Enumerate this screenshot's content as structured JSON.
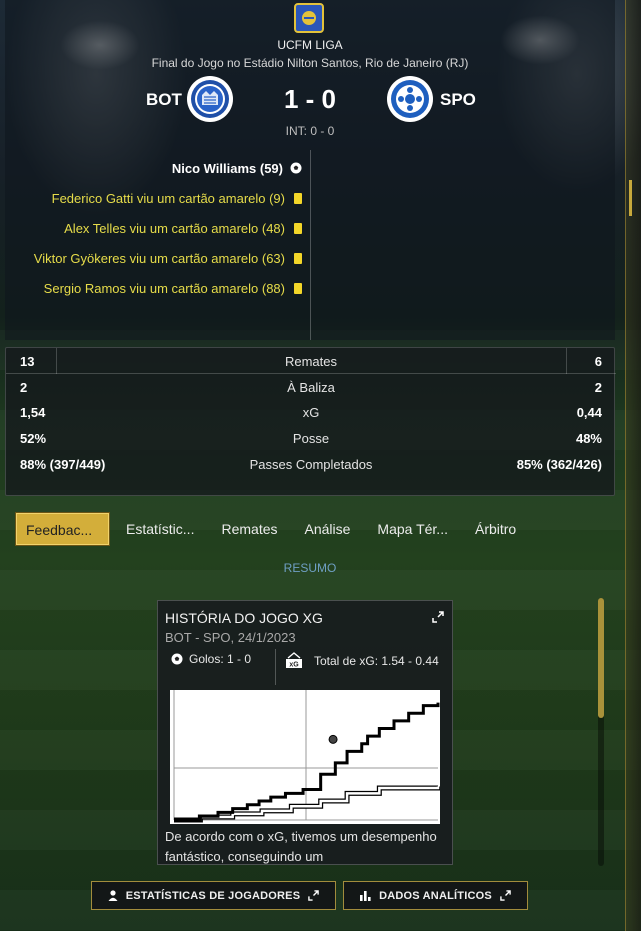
{
  "match": {
    "league": "UCFM LIGA",
    "venue": "Final do Jogo no Estádio Nilton Santos, Rio de Janeiro (RJ)",
    "home_abbr": "BOT",
    "away_abbr": "SPO",
    "score": "1 - 0",
    "halftime": "INT: 0 - 0"
  },
  "events": [
    {
      "text": "Nico Williams (59)",
      "type": "goal",
      "icon": "ball-icon"
    },
    {
      "text": "Federico Gatti viu um cartão amarelo (9)",
      "type": "yellow-card",
      "icon": "yellow-card-icon"
    },
    {
      "text": "Alex Telles viu um cartão amarelo (48)",
      "type": "yellow-card",
      "icon": "yellow-card-icon"
    },
    {
      "text": "Viktor Gyökeres viu um cartão amarelo (63)",
      "type": "yellow-card",
      "icon": "yellow-card-icon"
    },
    {
      "text": "Sergio Ramos viu um cartão amarelo (88)",
      "type": "yellow-card",
      "icon": "yellow-card-icon"
    }
  ],
  "stats": [
    {
      "label": "Remates",
      "home": "13",
      "away": "6"
    },
    {
      "label": "À Baliza",
      "home": "2",
      "away": "2"
    },
    {
      "label": "xG",
      "home": "1,54",
      "away": "0,44"
    },
    {
      "label": "Posse",
      "home": "52%",
      "away": "48%"
    },
    {
      "label": "Passes Completados",
      "home": "88% (397/449)",
      "away": "85% (362/426)"
    }
  ],
  "tabs": [
    "Feedbac...",
    "Estatístic...",
    "Remates",
    "Análise",
    "Mapa Tér...",
    "Árbitro"
  ],
  "active_tab": "Feedbac...",
  "section_label": "RESUMO",
  "xg_card": {
    "title": "HISTÓRIA DO JOGO XG",
    "subtitle": "BOT - SPO, 24/1/2023",
    "goals": "Golos: 1 - 0",
    "total_xg": "Total de xG: 1.54 - 0.44",
    "description": "De acordo com o xG, tivemos um desempenho fantástico, conseguindo um"
  },
  "chart_data": {
    "type": "line",
    "series": [
      {
        "x": [
          0,
          9,
          15,
          20,
          25,
          29,
          33,
          38,
          44,
          50,
          55,
          59,
          64,
          66,
          70,
          75,
          80,
          85,
          90
        ],
        "values": [
          0,
          0.05,
          0.1,
          0.15,
          0.2,
          0.25,
          0.3,
          0.35,
          0.4,
          0.6,
          0.75,
          0.9,
          1.0,
          1.1,
          1.2,
          1.3,
          1.4,
          1.5,
          1.54
        ],
        "color": "#000000"
      },
      {
        "x": [
          0,
          9,
          20,
          30,
          40,
          50,
          59,
          70,
          90
        ],
        "values": [
          0,
          0.04,
          0.08,
          0.12,
          0.18,
          0.25,
          0.35,
          0.42,
          0.44
        ],
        "color": "#ffffff"
      }
    ],
    "goal_markers": [
      59
    ],
    "xlim": [
      0,
      90
    ],
    "ylim": [
      0,
      1.6
    ],
    "title": "",
    "xlabel": "",
    "ylabel": ""
  },
  "buttons": {
    "players": "ESTATÍSTICAS DE JOGADORES",
    "analytics": "DADOS ANALÍTICOS"
  },
  "colors": {
    "accent": "#d3ae3a",
    "card_yellow": "#f3d629",
    "event_text": "#e6dc4a",
    "summary_blue": "#6f9fc4"
  }
}
